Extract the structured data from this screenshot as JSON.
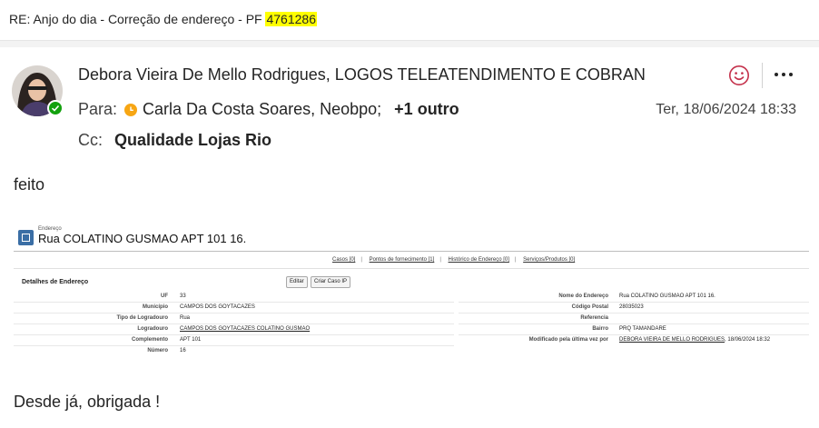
{
  "subject": {
    "prefix": "RE: Anjo do dia - Correção de endereço - PF ",
    "highlight": "4761286"
  },
  "message": {
    "sender": "Debora Vieira De Mello Rodrigues, LOGOS TELEATENDIMENTO E COBRAN",
    "to_label": "Para:",
    "to_names": "Carla Da Costa Soares, Neobpo;",
    "to_more": "+1 outro",
    "cc_label": "Cc:",
    "cc_name": "Qualidade Lojas Rio",
    "date": "Ter, 18/06/2024 18:33",
    "body_line1": "feito",
    "body_line2": "Desde já, obrigada !"
  },
  "embed": {
    "record_type": "Endereço",
    "title": "Rua COLATINO GUSMAO APT 101 16.",
    "links": [
      "Casos [0]",
      "Pontos de fornecimento [1]",
      "Histórico de Endereço [0]",
      "Serviços/Produtos [0]"
    ],
    "section_title": "Detalhes de Endereço",
    "btn_edit": "Editar",
    "btn_case": "Criar Caso IP",
    "left_fields": [
      {
        "label": "UF",
        "value": "33"
      },
      {
        "label": "Município",
        "value": "CAMPOS DOS GOYTACAZES"
      },
      {
        "label": "Tipo de Logradouro",
        "value": "Rua"
      },
      {
        "label": "Logradouro",
        "value": "CAMPOS DOS GOYTACAZES COLATINO GUSMAO"
      },
      {
        "label": "Complemento",
        "value": "APT 101"
      },
      {
        "label": "Número",
        "value": "16"
      }
    ],
    "right_fields": [
      {
        "label": "Nome do Endereço",
        "value": "Rua COLATINO GUSMAO APT 101 16."
      },
      {
        "label": "Código Postal",
        "value": "28035023"
      },
      {
        "label": "Referencia",
        "value": ""
      },
      {
        "label": "Bairro",
        "value": "PRQ TAMANDARE"
      },
      {
        "label": "Modificado pela última vez por",
        "value": "DEBORA VIEIRA DE MELLO RODRIGUES",
        "value_suffix": ", 18/06/2024 18:32"
      }
    ]
  },
  "colors": {
    "highlight": "#ffff00",
    "presence": "#13a10e",
    "clock": "#f7a614",
    "smiley": "#c4314b"
  },
  "icons": {
    "presence": "check-icon",
    "clock": "clock-icon",
    "smiley": "smiley-icon",
    "more": "more-icon"
  }
}
